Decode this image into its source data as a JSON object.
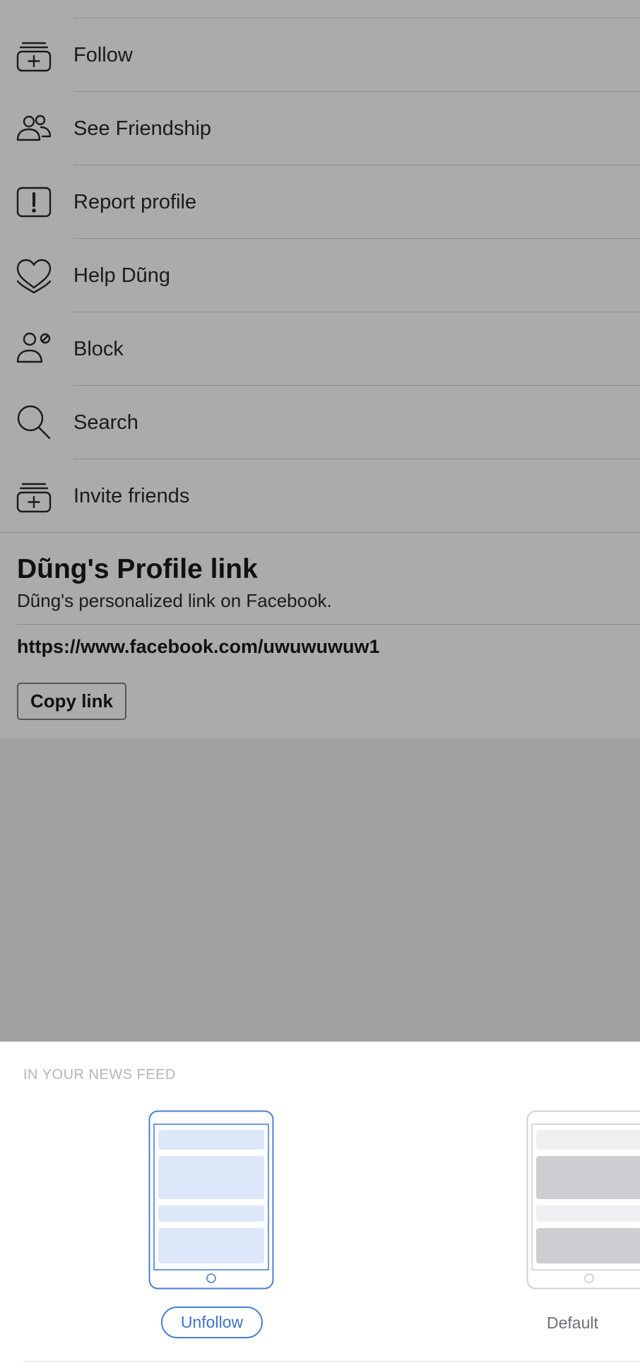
{
  "menu": {
    "items": [
      {
        "label": "Follow",
        "icon": "follow-icon"
      },
      {
        "label": "See Friendship",
        "icon": "friendship-icon"
      },
      {
        "label": "Report profile",
        "icon": "report-icon"
      },
      {
        "label": "Help Dũng",
        "icon": "heart-icon"
      },
      {
        "label": "Block",
        "icon": "block-user-icon"
      },
      {
        "label": "Search",
        "icon": "search-icon"
      },
      {
        "label": "Invite friends",
        "icon": "invite-icon"
      }
    ]
  },
  "profile_link": {
    "title": "Dũng's Profile link",
    "subtitle": "Dũng's personalized link on Facebook.",
    "url": "https://www.facebook.com/uwuwuwuw1",
    "copy_label": "Copy link"
  },
  "news_feed_sheet": {
    "heading": "IN YOUR NEWS FEED",
    "options": [
      {
        "label": "Unfollow",
        "selected": true
      },
      {
        "label": "Default",
        "selected": false
      }
    ]
  },
  "colors": {
    "overlay_page": "#ababab",
    "overlay_backdrop": "#a0a1a3",
    "accent_blue": "#4a80d0",
    "sheet_background": "#ffffff"
  }
}
